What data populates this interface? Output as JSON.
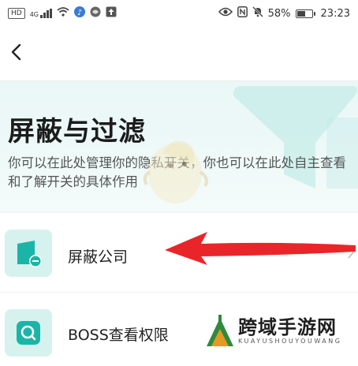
{
  "status_bar": {
    "left_icons": [
      "hd-icon",
      "4g-signal-icon",
      "wifi-icon",
      "music-icon",
      "browser-icon",
      "upload-icon"
    ],
    "hd_label": "HD",
    "network_label": "4G",
    "right_icons": [
      "eye-icon",
      "nfc-icon",
      "mute-icon",
      "battery-icon"
    ],
    "battery_percent": "58%",
    "battery_level": 0.58,
    "time": "23:23"
  },
  "nav": {
    "back_icon": "chevron-left-icon"
  },
  "hero": {
    "title": "屏蔽与过滤",
    "description": "你可以在此处管理你的隐私开关，你也可以在此处自主查看和了解开关的具体作用",
    "accent_color": "#1bb5a8",
    "background_color": "#eaf8f7"
  },
  "rows": [
    {
      "label": "屏蔽公司",
      "icon": "block-company-icon"
    },
    {
      "label": "BOSS查看权限",
      "icon": "search-icon"
    }
  ],
  "overlay": {
    "arrow_color": "#e8262a"
  },
  "watermark": {
    "text": "跨域手游网",
    "sub": "KUAYUSHOUYOUWANG"
  }
}
